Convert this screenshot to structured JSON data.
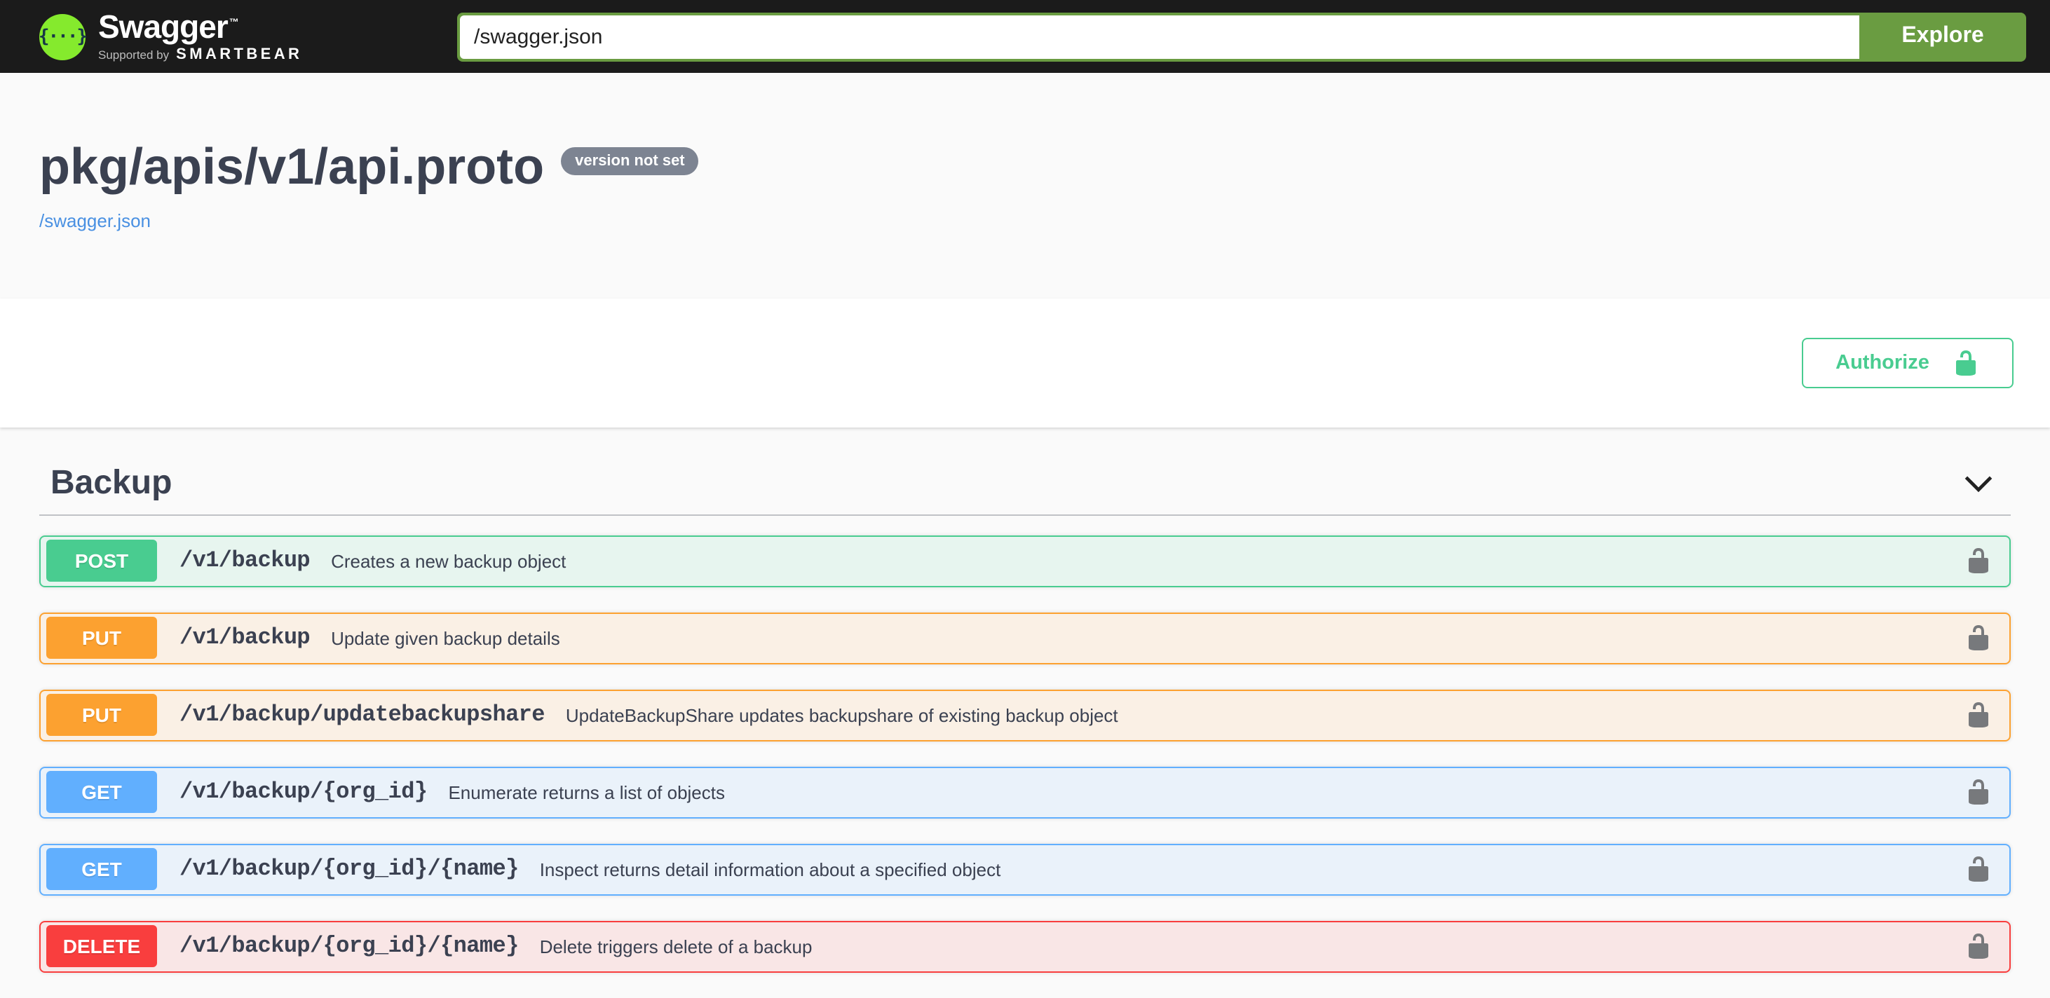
{
  "topbar": {
    "brand": "Swagger",
    "brand_tm": "™",
    "supported_by": "Supported by",
    "sponsor": "SMARTBEAR",
    "logo_braces": "{···}",
    "search_value": "/swagger.json",
    "explore_label": "Explore"
  },
  "info": {
    "title": "pkg/apis/v1/api.proto",
    "version_badge": "version not set",
    "spec_link": "/swagger.json"
  },
  "auth": {
    "authorize_label": "Authorize",
    "lock_icon": "unlocked-padlock-icon"
  },
  "section": {
    "title": "Backup",
    "collapse_icon": "chevron-down-icon"
  },
  "operations": [
    {
      "method": "POST",
      "path": "/v1/backup",
      "description": "Creates a new backup object"
    },
    {
      "method": "PUT",
      "path": "/v1/backup",
      "description": "Update given backup details"
    },
    {
      "method": "PUT",
      "path": "/v1/backup/updatebackupshare",
      "description": "UpdateBackupShare updates backupshare of existing backup object"
    },
    {
      "method": "GET",
      "path": "/v1/backup/{org_id}",
      "description": "Enumerate returns a list of objects"
    },
    {
      "method": "GET",
      "path": "/v1/backup/{org_id}/{name}",
      "description": "Inspect returns detail information about a specified object"
    },
    {
      "method": "DELETE",
      "path": "/v1/backup/{org_id}/{name}",
      "description": "Delete triggers delete of a backup"
    }
  ],
  "colors": {
    "topbar_bg": "#1b1b1b",
    "logo_green": "#85ea2d",
    "logo_braces_color": "#173647",
    "explore_green": "#6a9c41",
    "page_bg": "#fafafa",
    "heading_text": "#3b4151",
    "link_blue": "#4990e2",
    "version_badge_bg": "#7d8492",
    "authorize_green": "#49cc90",
    "lock_gray": "#77797c",
    "methods": {
      "POST": {
        "accent": "#49cc90",
        "bg": "rgba(73,204,144,0.1)"
      },
      "PUT": {
        "accent": "#fca130",
        "bg": "rgba(252,161,48,0.1)"
      },
      "GET": {
        "accent": "#61affe",
        "bg": "rgba(97,175,254,0.1)"
      },
      "DELETE": {
        "accent": "#f93e3e",
        "bg": "rgba(249,62,62,0.1)"
      }
    }
  }
}
